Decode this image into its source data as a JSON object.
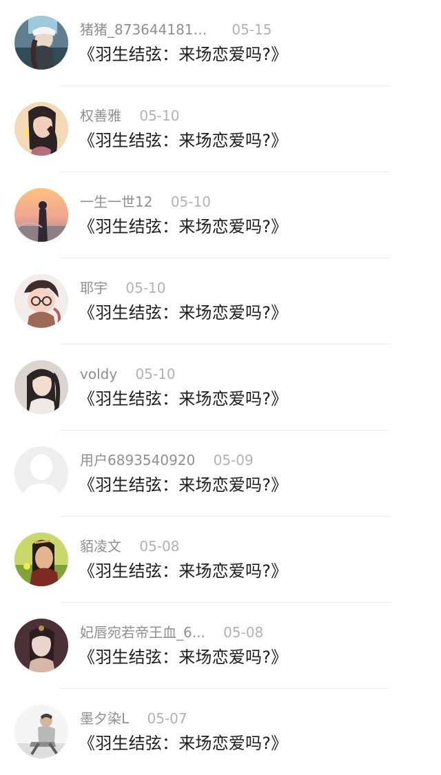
{
  "notifications": [
    {
      "user": "猪猪_8736441812...",
      "date": "05-15",
      "title": "《羽生结弦：来场恋爱吗?》",
      "avatar_icon": "woman-in-white-hat-avatar",
      "palette": {
        "bg": "#5f7f91",
        "accent": "#e8ecef",
        "skin": "#e9d7c8"
      }
    },
    {
      "user": "权善雅",
      "date": "05-10",
      "title": "《羽生结弦：来场恋爱吗?》",
      "avatar_icon": "anime-girl-avatar",
      "palette": {
        "bg": "#f3d9b6",
        "accent": "#2c2424",
        "skin": "#f2cfbb"
      }
    },
    {
      "user": "一生一世12",
      "date": "05-10",
      "title": "《羽生结弦：来场恋爱吗?》",
      "avatar_icon": "sunset-silhouette-avatar",
      "palette": {
        "bg": "#f4b17a",
        "accent": "#2f2830",
        "skin": "#d8a6a8"
      }
    },
    {
      "user": "耶宇",
      "date": "05-10",
      "title": "《羽生结弦：来场恋爱吗?》",
      "avatar_icon": "cartoon-boy-avatar",
      "palette": {
        "bg": "#f2ecea",
        "accent": "#3f2d2b",
        "skin": "#f4d3c5"
      }
    },
    {
      "user": "voldy",
      "date": "05-10",
      "title": "《羽生结弦：来场恋爱吗?》",
      "avatar_icon": "guzhuang-man-avatar",
      "palette": {
        "bg": "#dad6cf",
        "accent": "#2a2524",
        "skin": "#f0ddd0"
      }
    },
    {
      "user": "用户6893540920",
      "date": "05-09",
      "title": "《羽生结弦：来场恋爱吗?》",
      "avatar_icon": "default-user-avatar",
      "palette": {
        "bg": "#eeeeee",
        "accent": "#ffffff",
        "skin": "#ffffff"
      }
    },
    {
      "user": "貊凌文",
      "date": "05-08",
      "title": "《羽生结弦：来场恋爱吗?》",
      "avatar_icon": "warrior-woman-avatar",
      "palette": {
        "bg": "#c8d86a",
        "accent": "#7d2a24",
        "skin": "#e4b48f"
      }
    },
    {
      "user": "妃唇宛若帝王血_6...",
      "date": "05-08",
      "title": "《羽生结弦：来场恋爱吗?》",
      "avatar_icon": "ancient-beauty-avatar",
      "palette": {
        "bg": "#4b3135",
        "accent": "#d7b7a7",
        "skin": "#ead5cd"
      }
    },
    {
      "user": "墨夕染L",
      "date": "05-07",
      "title": "《羽生结弦：来场恋爱吗?》",
      "avatar_icon": "sitting-boy-avatar",
      "palette": {
        "bg": "#f5f5f5",
        "accent": "#8c8c8c",
        "skin": "#d7b49b"
      }
    }
  ]
}
